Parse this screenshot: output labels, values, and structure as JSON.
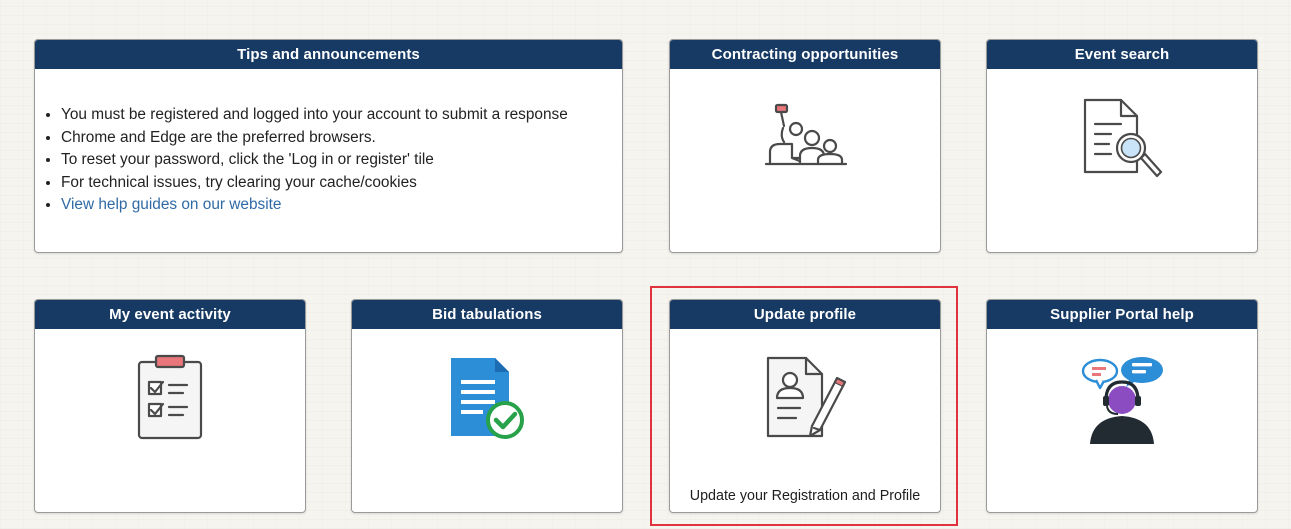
{
  "tiles": {
    "tips": {
      "title": "Tips and announcements",
      "items": [
        "You must be registered and logged into your account to submit a response",
        "Chrome and Edge are the preferred browsers.",
        "To reset your password, click the 'Log in or register' tile",
        "For technical issues, try clearing your cache/cookies"
      ],
      "link": "View help guides on our website"
    },
    "contracting": {
      "title": "Contracting opportunities",
      "icon": "people-raising-hand-icon"
    },
    "event_search": {
      "title": "Event search",
      "icon": "document-search-icon"
    },
    "event_activity": {
      "title": "My event activity",
      "icon": "clipboard-checklist-icon"
    },
    "bid_tabulations": {
      "title": "Bid tabulations",
      "icon": "document-checkmark-icon"
    },
    "update_profile": {
      "title": "Update profile",
      "icon": "profile-edit-icon",
      "footer": "Update your Registration and Profile"
    },
    "portal_help": {
      "title": "Supplier Portal help",
      "icon": "support-agent-icon"
    }
  },
  "colors": {
    "header_bg": "#173a64",
    "link": "#2f6aa6",
    "highlight": "#e0333d",
    "icon_red": "#e8767b",
    "icon_blue": "#2d8ed8",
    "icon_green": "#27a14a",
    "icon_purple": "#8b4bc1"
  }
}
